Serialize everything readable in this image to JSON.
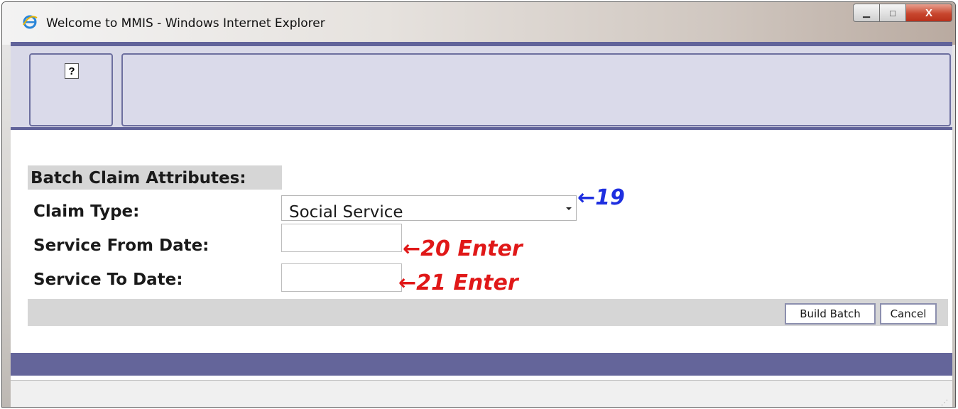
{
  "window": {
    "title": "Welcome to MMIS - Windows Internet Explorer",
    "icon": "ie-icon",
    "controls": {
      "minimize": "▁",
      "maximize": "□",
      "close": "X"
    }
  },
  "toolbar": {
    "help_label": "?"
  },
  "form": {
    "section_title": "Batch Claim Attributes:",
    "claim_type": {
      "label": "Claim Type:",
      "value": "Social Service"
    },
    "service_from_date": {
      "label": "Service From Date:",
      "value": ""
    },
    "service_to_date": {
      "label": "Service To Date:",
      "value": ""
    }
  },
  "annotations": {
    "a19": "19",
    "a20": "20 Enter",
    "a21": "21 Enter",
    "colors": {
      "blue": "#1e2fe0",
      "red": "#e01818"
    }
  },
  "actions": {
    "build_batch": "Build Batch",
    "cancel": "Cancel"
  },
  "colors": {
    "accent": "#61639a",
    "panel": "#d9d9e8"
  }
}
